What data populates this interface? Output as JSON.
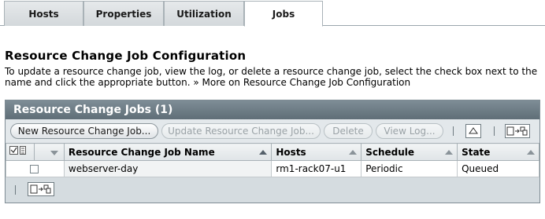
{
  "tabs": [
    {
      "label": "Hosts"
    },
    {
      "label": "Properties"
    },
    {
      "label": "Utilization"
    },
    {
      "label": "Jobs",
      "active": true
    }
  ],
  "page": {
    "title": "Resource Change Job Configuration",
    "description": "To update a resource change job, view the log, or delete a resource change job, select the check box next to the name and click the appropriate button.",
    "more_link": "» More on Resource Change Job Configuration"
  },
  "table": {
    "title": "Resource Change Jobs (1)",
    "buttons": {
      "new": "New Resource Change Job...",
      "update": "Update Resource Change Job...",
      "delete": "Delete",
      "view_log": "View Log..."
    },
    "columns": [
      "Resource Change Job Name",
      "Hosts",
      "Schedule",
      "State"
    ],
    "rows": [
      {
        "name": "webserver-day",
        "hosts": "rm1-rack07-u1",
        "schedule": "Periodic",
        "state": "Queued"
      }
    ]
  },
  "colors": {
    "panel_header": "#6f7e87",
    "tab_active": "#ffffff",
    "button_disabled_text": "#9aa2a6"
  }
}
